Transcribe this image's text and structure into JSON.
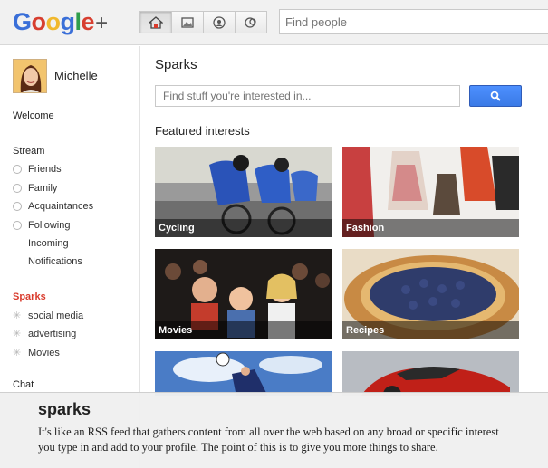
{
  "header": {
    "logo_google": "Google",
    "logo_plus": "+",
    "nav_icons": [
      "home-icon",
      "photos-icon",
      "profile-icon",
      "circles-icon"
    ],
    "search_placeholder": "Find people"
  },
  "sidebar": {
    "profile_name": "Michelle",
    "welcome": "Welcome",
    "stream": "Stream",
    "stream_items": [
      "Friends",
      "Family",
      "Acquaintances",
      "Following",
      "Incoming",
      "Notifications"
    ],
    "sparks": "Sparks",
    "spark_items": [
      "social media",
      "advertising",
      "Movies"
    ],
    "chat": "Chat"
  },
  "main": {
    "title": "Sparks",
    "search_placeholder": "Find stuff you're interested in...",
    "featured_title": "Featured interests",
    "interests": [
      "Cycling",
      "Fashion",
      "Movies",
      "Recipes",
      "",
      ""
    ]
  },
  "caption": {
    "title": "sparks",
    "text": "It's like an RSS feed that gathers content from all over the web based on any broad or specific interest you type in and add to your profile. The point of this is to give you more things to share."
  },
  "colors": {
    "accent_blue": "#4d90fe",
    "sparks_red": "#d93a2b"
  }
}
